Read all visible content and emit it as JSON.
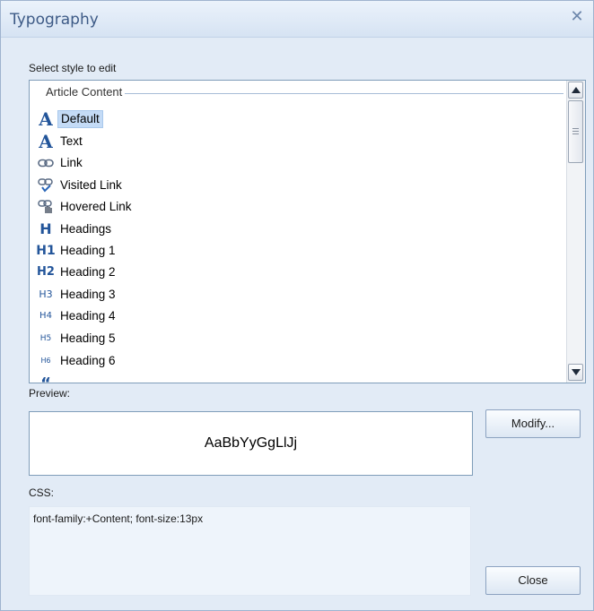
{
  "dialog": {
    "title": "Typography",
    "close_icon": "close-x-icon"
  },
  "styles": {
    "label": "Select style to edit",
    "group": "Article Content",
    "selected_index": 0,
    "items": [
      {
        "label": "Default",
        "icon": "A"
      },
      {
        "label": "Text",
        "icon": "A"
      },
      {
        "label": "Link",
        "icon": "link-chain"
      },
      {
        "label": "Visited Link",
        "icon": "link-check"
      },
      {
        "label": "Hovered Link",
        "icon": "link-hand"
      },
      {
        "label": "Headings",
        "icon": "H"
      },
      {
        "label": "Heading 1",
        "icon": "H1"
      },
      {
        "label": "Heading 2",
        "icon": "H2"
      },
      {
        "label": "Heading 3",
        "icon": "H3"
      },
      {
        "label": "Heading 4",
        "icon": "H4"
      },
      {
        "label": "Heading 5",
        "icon": "H5"
      },
      {
        "label": "Heading 6",
        "icon": "H6"
      }
    ]
  },
  "preview": {
    "label": "Preview:",
    "sample": "AaBbYyGgLlJj"
  },
  "css": {
    "label": "CSS:",
    "value": "font-family:+Content; font-size:13px"
  },
  "buttons": {
    "modify": "Modify...",
    "close": "Close"
  },
  "colors": {
    "dialog_bg": "#e2ebf6",
    "title": "#3d5a86",
    "icon_blue": "#23559a",
    "selection": "#c4dbf6"
  }
}
